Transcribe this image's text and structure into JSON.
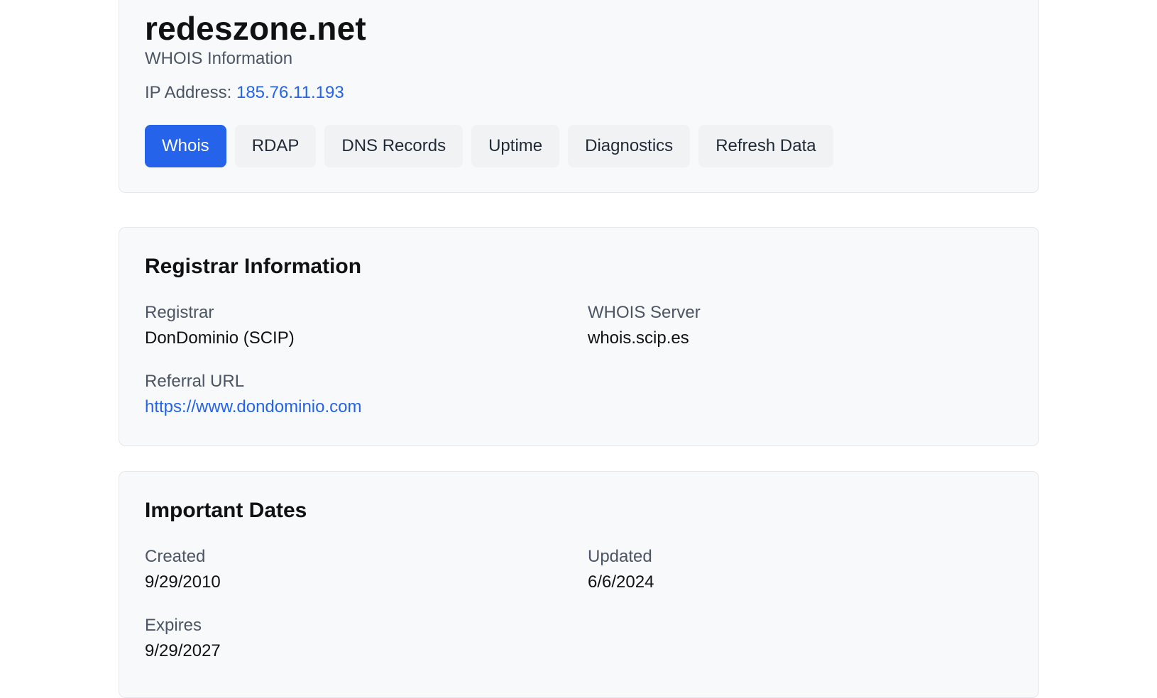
{
  "header": {
    "domain": "redeszone.net",
    "subtitle": "WHOIS Information",
    "ip_label": "IP Address:",
    "ip_value": "185.76.11.193",
    "tabs": [
      {
        "label": "Whois",
        "active": true
      },
      {
        "label": "RDAP",
        "active": false
      },
      {
        "label": "DNS Records",
        "active": false
      },
      {
        "label": "Uptime",
        "active": false
      },
      {
        "label": "Diagnostics",
        "active": false
      },
      {
        "label": "Refresh Data",
        "active": false
      }
    ]
  },
  "registrar": {
    "title": "Registrar Information",
    "registrar_label": "Registrar",
    "registrar_value": "DonDominio (SCIP)",
    "whois_server_label": "WHOIS Server",
    "whois_server_value": "whois.scip.es",
    "referral_label": "Referral URL",
    "referral_value": "https://www.dondominio.com"
  },
  "dates": {
    "title": "Important Dates",
    "created_label": "Created",
    "created_value": "9/29/2010",
    "updated_label": "Updated",
    "updated_value": "6/6/2024",
    "expires_label": "Expires",
    "expires_value": "9/29/2027"
  },
  "colors": {
    "accent": "#2563eb",
    "card_bg": "#f8f9fb",
    "tab_bg": "#f1f2f4"
  }
}
